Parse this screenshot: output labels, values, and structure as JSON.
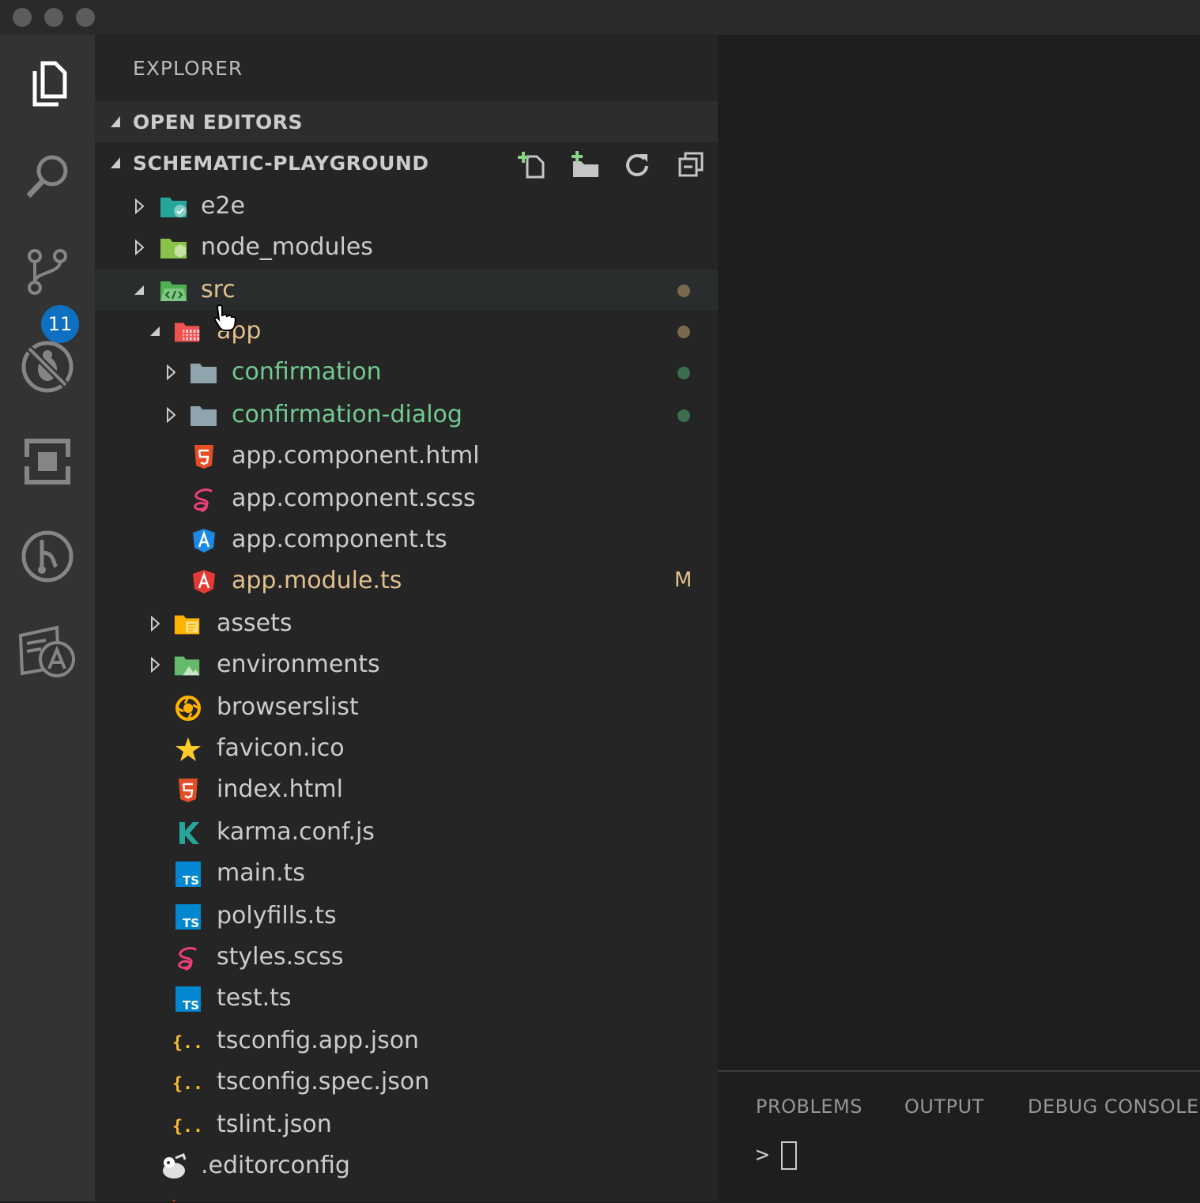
{
  "activity_bar": {
    "items": [
      {
        "name": "explorer-icon"
      },
      {
        "name": "search-icon"
      },
      {
        "name": "source-control-icon"
      },
      {
        "name": "debug-icon"
      },
      {
        "name": "extensions-icon"
      },
      {
        "name": "git-history-icon"
      },
      {
        "name": "translate-icon"
      }
    ],
    "source_control_badge": "11"
  },
  "sidebar": {
    "title": "EXPLORER",
    "open_editors": "OPEN EDITORS",
    "project": "SCHEMATIC-PLAYGROUND",
    "actions": [
      "new-file-icon",
      "new-folder-icon",
      "refresh-icon",
      "collapse-all-icon"
    ]
  },
  "tree": [
    {
      "label": "e2e",
      "icon": "folder-e2e-icon",
      "color": "#cccccc"
    },
    {
      "label": "node_modules",
      "icon": "folder-node-icon",
      "color": "#cccccc"
    },
    {
      "label": "src",
      "icon": "folder-src-icon",
      "color": "#e2c08d"
    },
    {
      "label": "app",
      "icon": "folder-app-icon",
      "color": "#e2c08d"
    },
    {
      "label": "confirmation",
      "icon": "folder-icon",
      "color": "#73c991"
    },
    {
      "label": "confirmation-dialog",
      "icon": "folder-icon",
      "color": "#73c991"
    },
    {
      "label": "app.component.html",
      "icon": "html5-icon",
      "color": "#cccccc"
    },
    {
      "label": "app.component.scss",
      "icon": "sass-icon",
      "color": "#cccccc"
    },
    {
      "label": "app.component.ts",
      "icon": "angular-component-icon",
      "color": "#cccccc"
    },
    {
      "label": "app.module.ts",
      "icon": "angular-module-icon",
      "color": "#e2c08d",
      "status": "M"
    },
    {
      "label": "assets",
      "icon": "folder-assets-icon",
      "color": "#cccccc"
    },
    {
      "label": "environments",
      "icon": "folder-environment-icon",
      "color": "#cccccc"
    },
    {
      "label": "browserslist",
      "icon": "browserslist-icon",
      "color": "#cccccc"
    },
    {
      "label": "favicon.ico",
      "icon": "star-icon",
      "color": "#cccccc"
    },
    {
      "label": "index.html",
      "icon": "html5-icon",
      "color": "#cccccc"
    },
    {
      "label": "karma.conf.js",
      "icon": "karma-icon",
      "color": "#cccccc"
    },
    {
      "label": "main.ts",
      "icon": "typescript-icon",
      "color": "#cccccc"
    },
    {
      "label": "polyfills.ts",
      "icon": "typescript-icon",
      "color": "#cccccc"
    },
    {
      "label": "styles.scss",
      "icon": "sass-icon",
      "color": "#cccccc"
    },
    {
      "label": "test.ts",
      "icon": "typescript-icon",
      "color": "#cccccc"
    },
    {
      "label": "tsconfig.app.json",
      "icon": "json-icon",
      "color": "#cccccc"
    },
    {
      "label": "tsconfig.spec.json",
      "icon": "json-icon",
      "color": "#cccccc"
    },
    {
      "label": "tslint.json",
      "icon": "json-icon",
      "color": "#cccccc"
    },
    {
      "label": ".editorconfig",
      "icon": "editorconfig-icon",
      "color": "#cccccc"
    }
  ],
  "panel": {
    "tabs": [
      "PROBLEMS",
      "OUTPUT",
      "DEBUG CONSOLE"
    ],
    "prompt": ">"
  }
}
